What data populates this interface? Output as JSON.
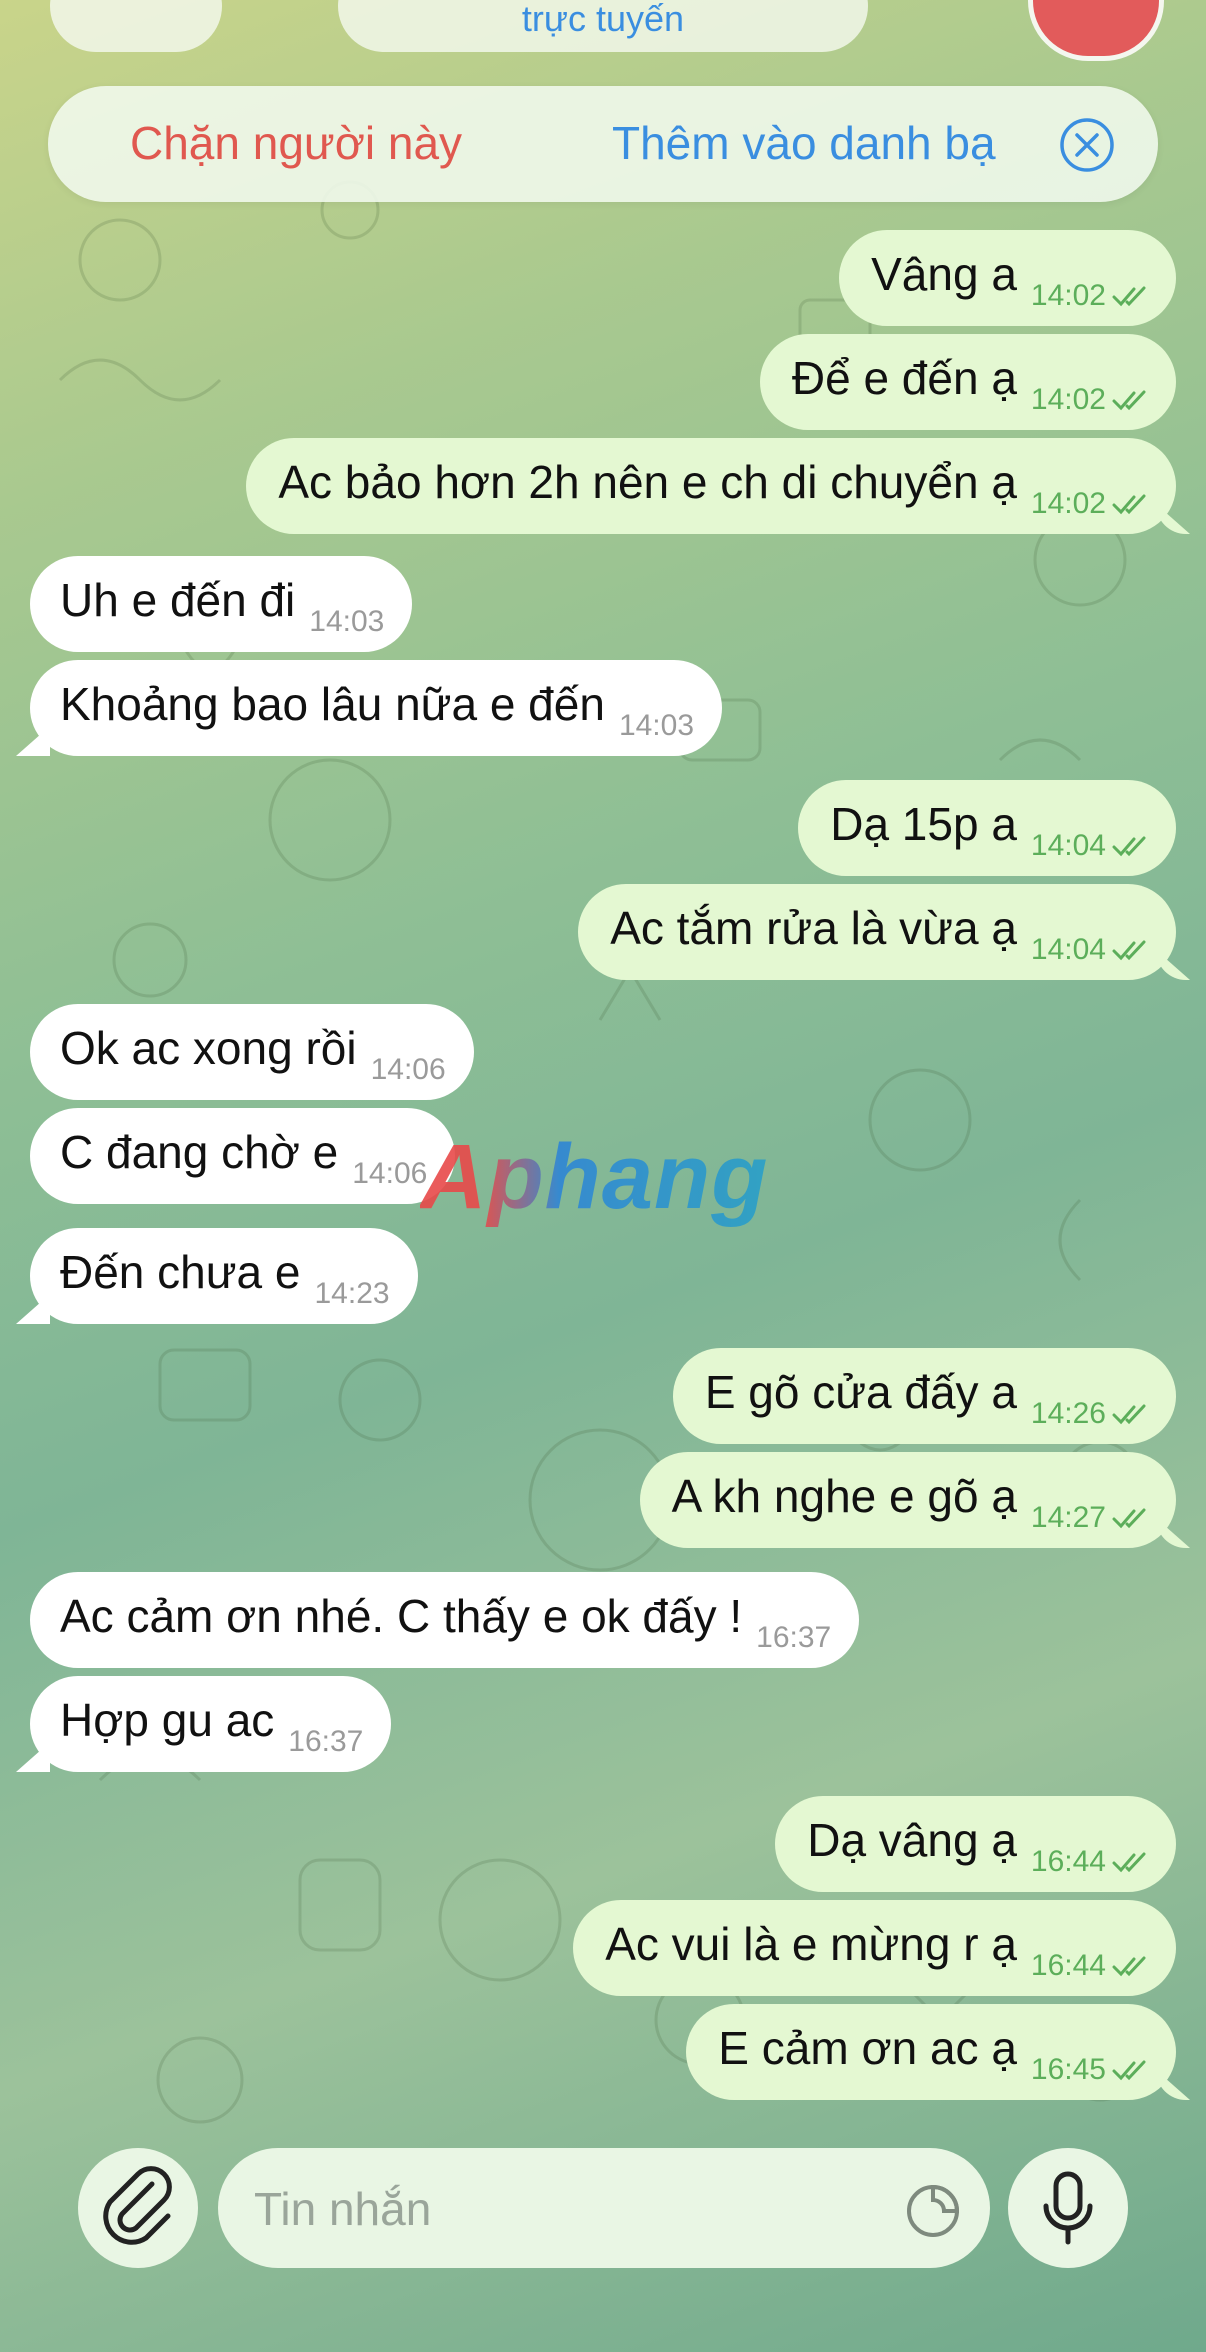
{
  "header": {
    "status": "trực tuyến"
  },
  "banner": {
    "block_label": "Chặn người này",
    "add_label": "Thêm vào danh bạ"
  },
  "messages": [
    {
      "dir": "out",
      "text": "Vâng a",
      "time": "14:02"
    },
    {
      "dir": "out",
      "text": "Để e đến ạ",
      "time": "14:02"
    },
    {
      "dir": "out",
      "text": "Ac bảo hơn 2h nên e ch di chuyển ạ",
      "time": "14:02"
    },
    {
      "dir": "in",
      "text": "Uh e đến đi",
      "time": "14:03"
    },
    {
      "dir": "in",
      "text": "Khoảng bao lâu nữa e đến",
      "time": "14:03"
    },
    {
      "dir": "out",
      "text": "Dạ 15p a",
      "time": "14:04"
    },
    {
      "dir": "out",
      "text": "Ac tắm rửa là vừa ạ",
      "time": "14:04"
    },
    {
      "dir": "in",
      "text": "Ok ac xong rồi",
      "time": "14:06"
    },
    {
      "dir": "in",
      "text": "C đang chờ e",
      "time": "14:06"
    },
    {
      "dir": "in",
      "text": "Đến chưa e",
      "time": "14:23"
    },
    {
      "dir": "out",
      "text": "E gõ cửa đấy a",
      "time": "14:26"
    },
    {
      "dir": "out",
      "text": "A kh nghe e gõ ạ",
      "time": "14:27"
    },
    {
      "dir": "in",
      "text": "Ac cảm ơn nhé. C thấy e ok đấy !",
      "time": "16:37"
    },
    {
      "dir": "in",
      "text": "Hợp gu ac",
      "time": "16:37"
    },
    {
      "dir": "out",
      "text": "Dạ vâng ạ",
      "time": "16:44"
    },
    {
      "dir": "out",
      "text": "Ac vui là e mừng r ạ",
      "time": "16:44"
    },
    {
      "dir": "out",
      "text": "E cảm ơn ac ạ",
      "time": "16:45"
    }
  ],
  "watermark": "Aphang",
  "composer": {
    "placeholder": "Tin nhắn"
  },
  "icons": {
    "close": "close-circle-icon",
    "attach": "paperclip-icon",
    "sticker": "sticker-icon",
    "mic": "microphone-icon",
    "read": "double-check-icon"
  },
  "colors": {
    "outgoing_bubble": "#e4f8d2",
    "incoming_bubble": "#ffffff",
    "time_outgoing": "#5cae5a",
    "block_red": "#e0584f",
    "link_blue": "#3a8ee0"
  }
}
